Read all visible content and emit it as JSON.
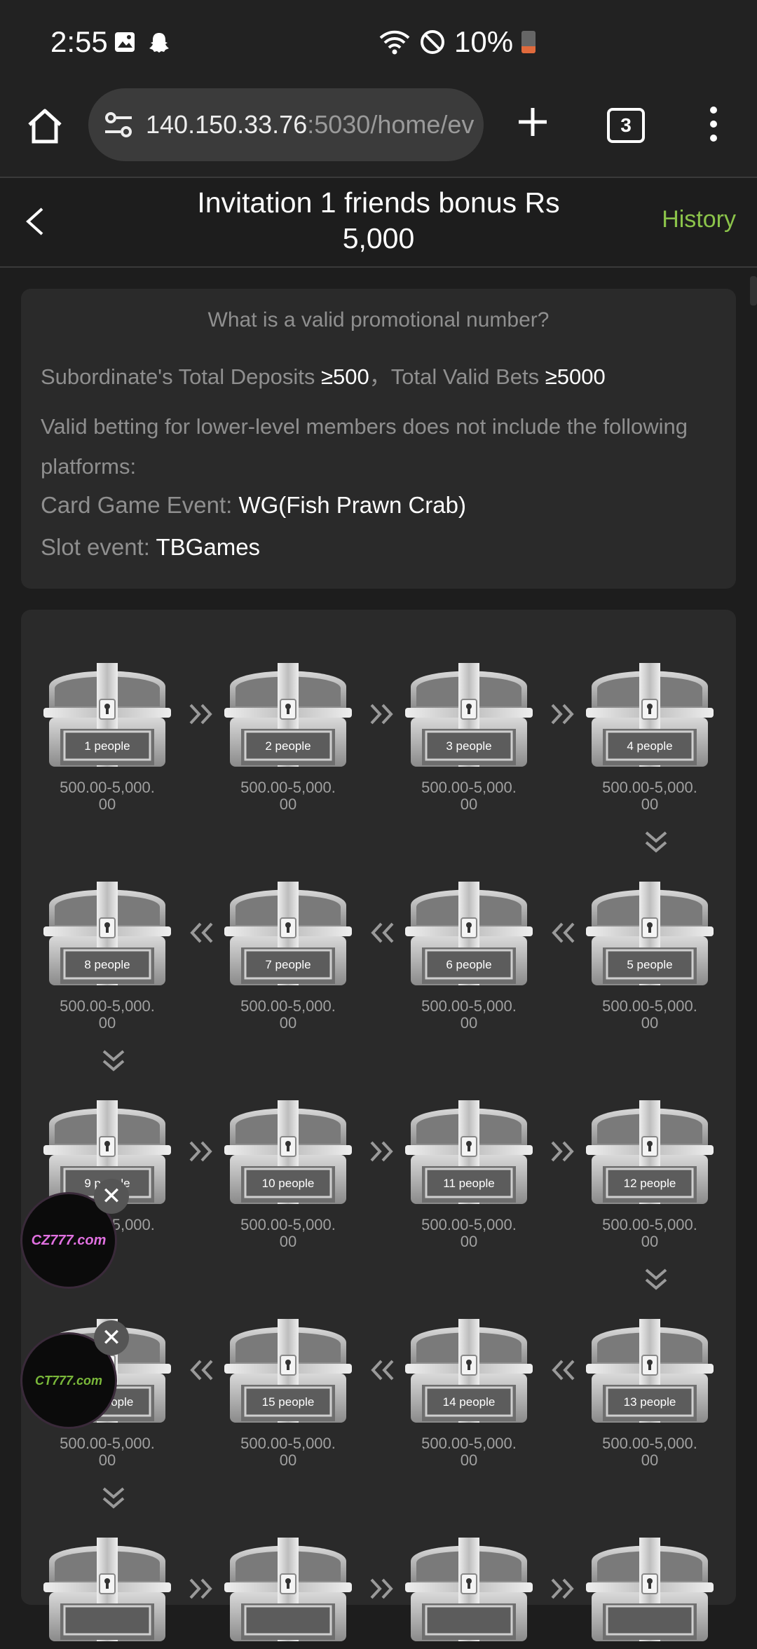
{
  "status": {
    "time": "2:55",
    "battery": "10%",
    "battery_level": 0.1
  },
  "browser": {
    "url_host": "140.150.33.76",
    "url_rest": ":5030/home/eve",
    "tab_count": "3"
  },
  "header": {
    "title_line1": "Invitation 1 friends bonus Rs",
    "title_line2": "5,000",
    "history": "History"
  },
  "info": {
    "question": "What is a valid promotional number?",
    "deposits_label": "Subordinate's Total Deposits ",
    "deposits_value": "≥500",
    "sep": "，",
    "bets_label": "Total Valid Bets ",
    "bets_value": "≥5000",
    "note": "Valid betting for lower-level members does not include the following platforms:",
    "card_label": "Card Game Event: ",
    "card_value": "WG(Fish Prawn Crab)",
    "slot_label": "Slot event: ",
    "slot_value": "TBGames"
  },
  "chests": [
    {
      "label": "1 people",
      "amount_line1": "500.00-5,000.",
      "amount_line2": "00"
    },
    {
      "label": "2 people",
      "amount_line1": "500.00-5,000.",
      "amount_line2": "00"
    },
    {
      "label": "3 people",
      "amount_line1": "500.00-5,000.",
      "amount_line2": "00"
    },
    {
      "label": "4 people",
      "amount_line1": "500.00-5,000.",
      "amount_line2": "00"
    },
    {
      "label": "5 people",
      "amount_line1": "500.00-5,000.",
      "amount_line2": "00"
    },
    {
      "label": "6 people",
      "amount_line1": "500.00-5,000.",
      "amount_line2": "00"
    },
    {
      "label": "7 people",
      "amount_line1": "500.00-5,000.",
      "amount_line2": "00"
    },
    {
      "label": "8 people",
      "amount_line1": "500.00-5,000.",
      "amount_line2": "00"
    },
    {
      "label": "9 people",
      "amount_line1": "500.00-5,000.",
      "amount_line2": "00"
    },
    {
      "label": "10 people",
      "amount_line1": "500.00-5,000.",
      "amount_line2": "00"
    },
    {
      "label": "11 people",
      "amount_line1": "500.00-5,000.",
      "amount_line2": "00"
    },
    {
      "label": "12 people",
      "amount_line1": "500.00-5,000.",
      "amount_line2": "00"
    },
    {
      "label": "13 people",
      "amount_line1": "500.00-5,000.",
      "amount_line2": "00"
    },
    {
      "label": "14 people",
      "amount_line1": "500.00-5,000.",
      "amount_line2": "00"
    },
    {
      "label": "15 people",
      "amount_line1": "500.00-5,000.",
      "amount_line2": "00"
    },
    {
      "label": "16 people",
      "amount_line1": "500.00-5,000.",
      "amount_line2": "00"
    }
  ],
  "ads": {
    "ad1": "CZ777.com",
    "ad2": "CT777.com",
    "close": "✕"
  },
  "colors": {
    "accent": "#8bc34a",
    "bg": "#1d1d1d",
    "card": "#2a2a2a"
  }
}
